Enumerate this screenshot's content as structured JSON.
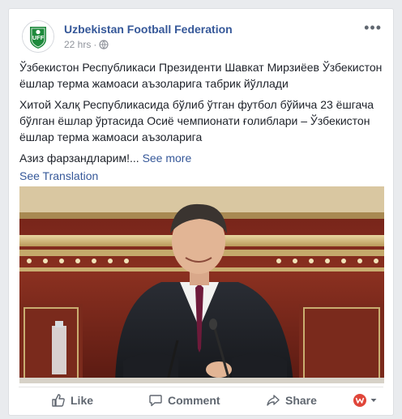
{
  "post": {
    "page_name": "Uzbekistan Football Federation",
    "time": "22 hrs",
    "separator": "·",
    "avatar_text": "UFF",
    "paragraph1": "Ўзбекистон Республикаси Президенти Шавкат Мирзиёев Ўзбекистон ёшлар терма жамоаси аъзоларига табрик йўллади",
    "paragraph2": "Хитой Халқ Республикасида бўлиб ўтган футбол бўйича 23 ёшгача бўлган ёшлар ўртасида Осиё чемпионати ғолиблари – Ўзбекистон ёшлар терма жамоаси аъзоларига",
    "paragraph3": "Азиз фарзандларим!...",
    "see_more": "See more",
    "see_translation": "See Translation"
  },
  "actions": {
    "like": "Like",
    "comment": "Comment",
    "share": "Share"
  },
  "colors": {
    "link": "#365899",
    "muted": "#606770",
    "brand_green": "#1e8a3c",
    "reaction_red": "#e0463a"
  }
}
